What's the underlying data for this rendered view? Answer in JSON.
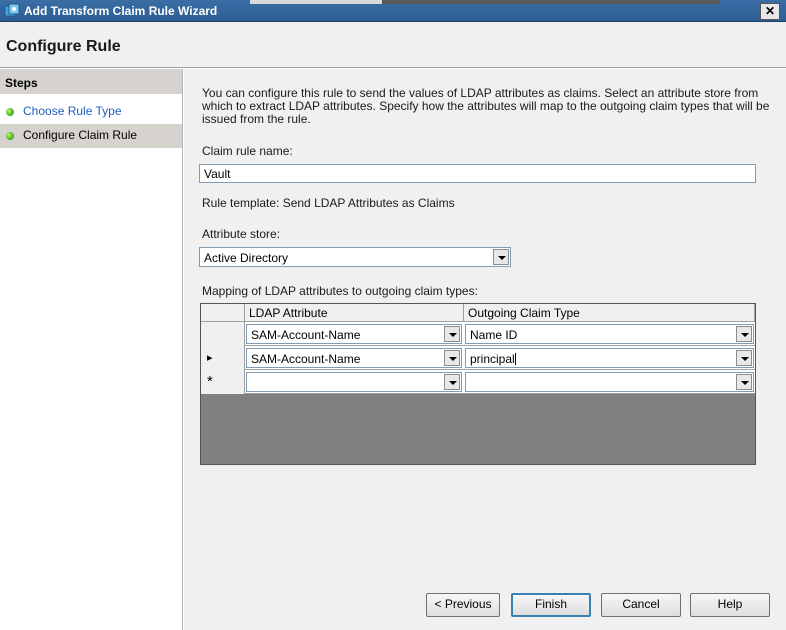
{
  "window": {
    "title": "Add Transform Claim Rule Wizard",
    "close_glyph": "✕"
  },
  "header": {
    "title": "Configure Rule"
  },
  "sidebar": {
    "heading": "Steps",
    "items": [
      {
        "label": "Choose Rule Type",
        "state": "link"
      },
      {
        "label": "Configure Claim Rule",
        "state": "current"
      }
    ]
  },
  "main": {
    "intro": "You can configure this rule to send the values of LDAP attributes as claims. Select an attribute store from which to extract LDAP attributes. Specify how the attributes will map to the outgoing claim types that will be issued from the rule.",
    "claim_rule_name_label": "Claim rule name:",
    "claim_rule_name_value": "Vault",
    "rule_template_text": "Rule template: Send LDAP Attributes as Claims",
    "attribute_store_label": "Attribute store:",
    "attribute_store_value": "Active Directory",
    "mapping_label": "Mapping of LDAP attributes to outgoing claim types:",
    "grid": {
      "columns": [
        "LDAP Attribute",
        "Outgoing Claim Type"
      ],
      "rows": [
        {
          "marker": "",
          "ldap": "SAM-Account-Name",
          "claim": "Name ID"
        },
        {
          "marker": "▸",
          "ldap": "SAM-Account-Name",
          "claim": "principal"
        },
        {
          "marker": "*",
          "ldap": "",
          "claim": ""
        }
      ]
    }
  },
  "footer": {
    "previous": "< Previous",
    "finish": "Finish",
    "cancel": "Cancel",
    "help": "Help"
  },
  "icons": {
    "title": "wizard-icon",
    "step_status": "green-dot-icon",
    "dropdown": "chevron-down-icon"
  },
  "colors": {
    "titlebar": "#2d5d95",
    "link": "#1f5fbf",
    "status_dot": "#4bb21c"
  }
}
